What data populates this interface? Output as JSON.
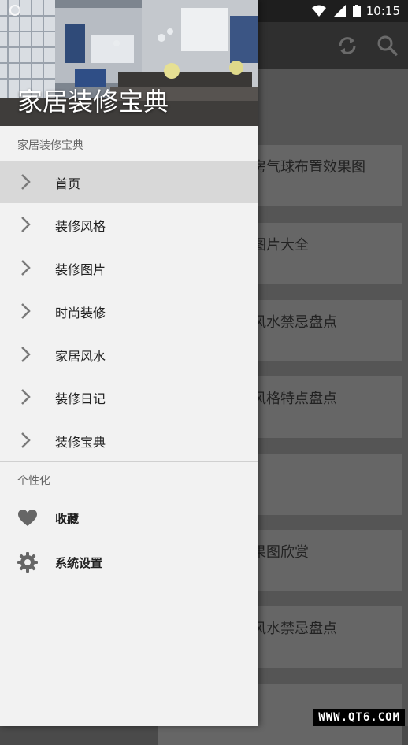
{
  "status_bar": {
    "time": "10:15"
  },
  "background_cards": [
    {
      "title": "房气球布置效果图"
    },
    {
      "title": "图片大全"
    },
    {
      "title": "风水禁忌盘点"
    },
    {
      "title": "风格特点盘点"
    },
    {
      "title": ""
    },
    {
      "title": "果图欣赏"
    },
    {
      "title": "风水禁忌盘点"
    },
    {
      "title": ""
    }
  ],
  "drawer": {
    "header_title": "家居装修宝典",
    "section_main_label": "家居装修宝典",
    "nav_items": [
      {
        "label": "首页",
        "active": true
      },
      {
        "label": "装修风格"
      },
      {
        "label": "装修图片"
      },
      {
        "label": "时尚装修"
      },
      {
        "label": "家居风水"
      },
      {
        "label": "装修日记"
      },
      {
        "label": "装修宝典"
      }
    ],
    "section_personal_label": "个性化",
    "personal_items": [
      {
        "label": "收藏",
        "icon": "heart-icon"
      },
      {
        "label": "系统设置",
        "icon": "gear-icon"
      }
    ]
  },
  "watermark": "WWW.QT6.COM",
  "colors": {
    "drawer_bg": "#f2f2f2",
    "active_item_bg": "#d8d8d8",
    "toolbar_bg": "#2f2f2f",
    "scrim_bg": "#4a4a4a"
  }
}
